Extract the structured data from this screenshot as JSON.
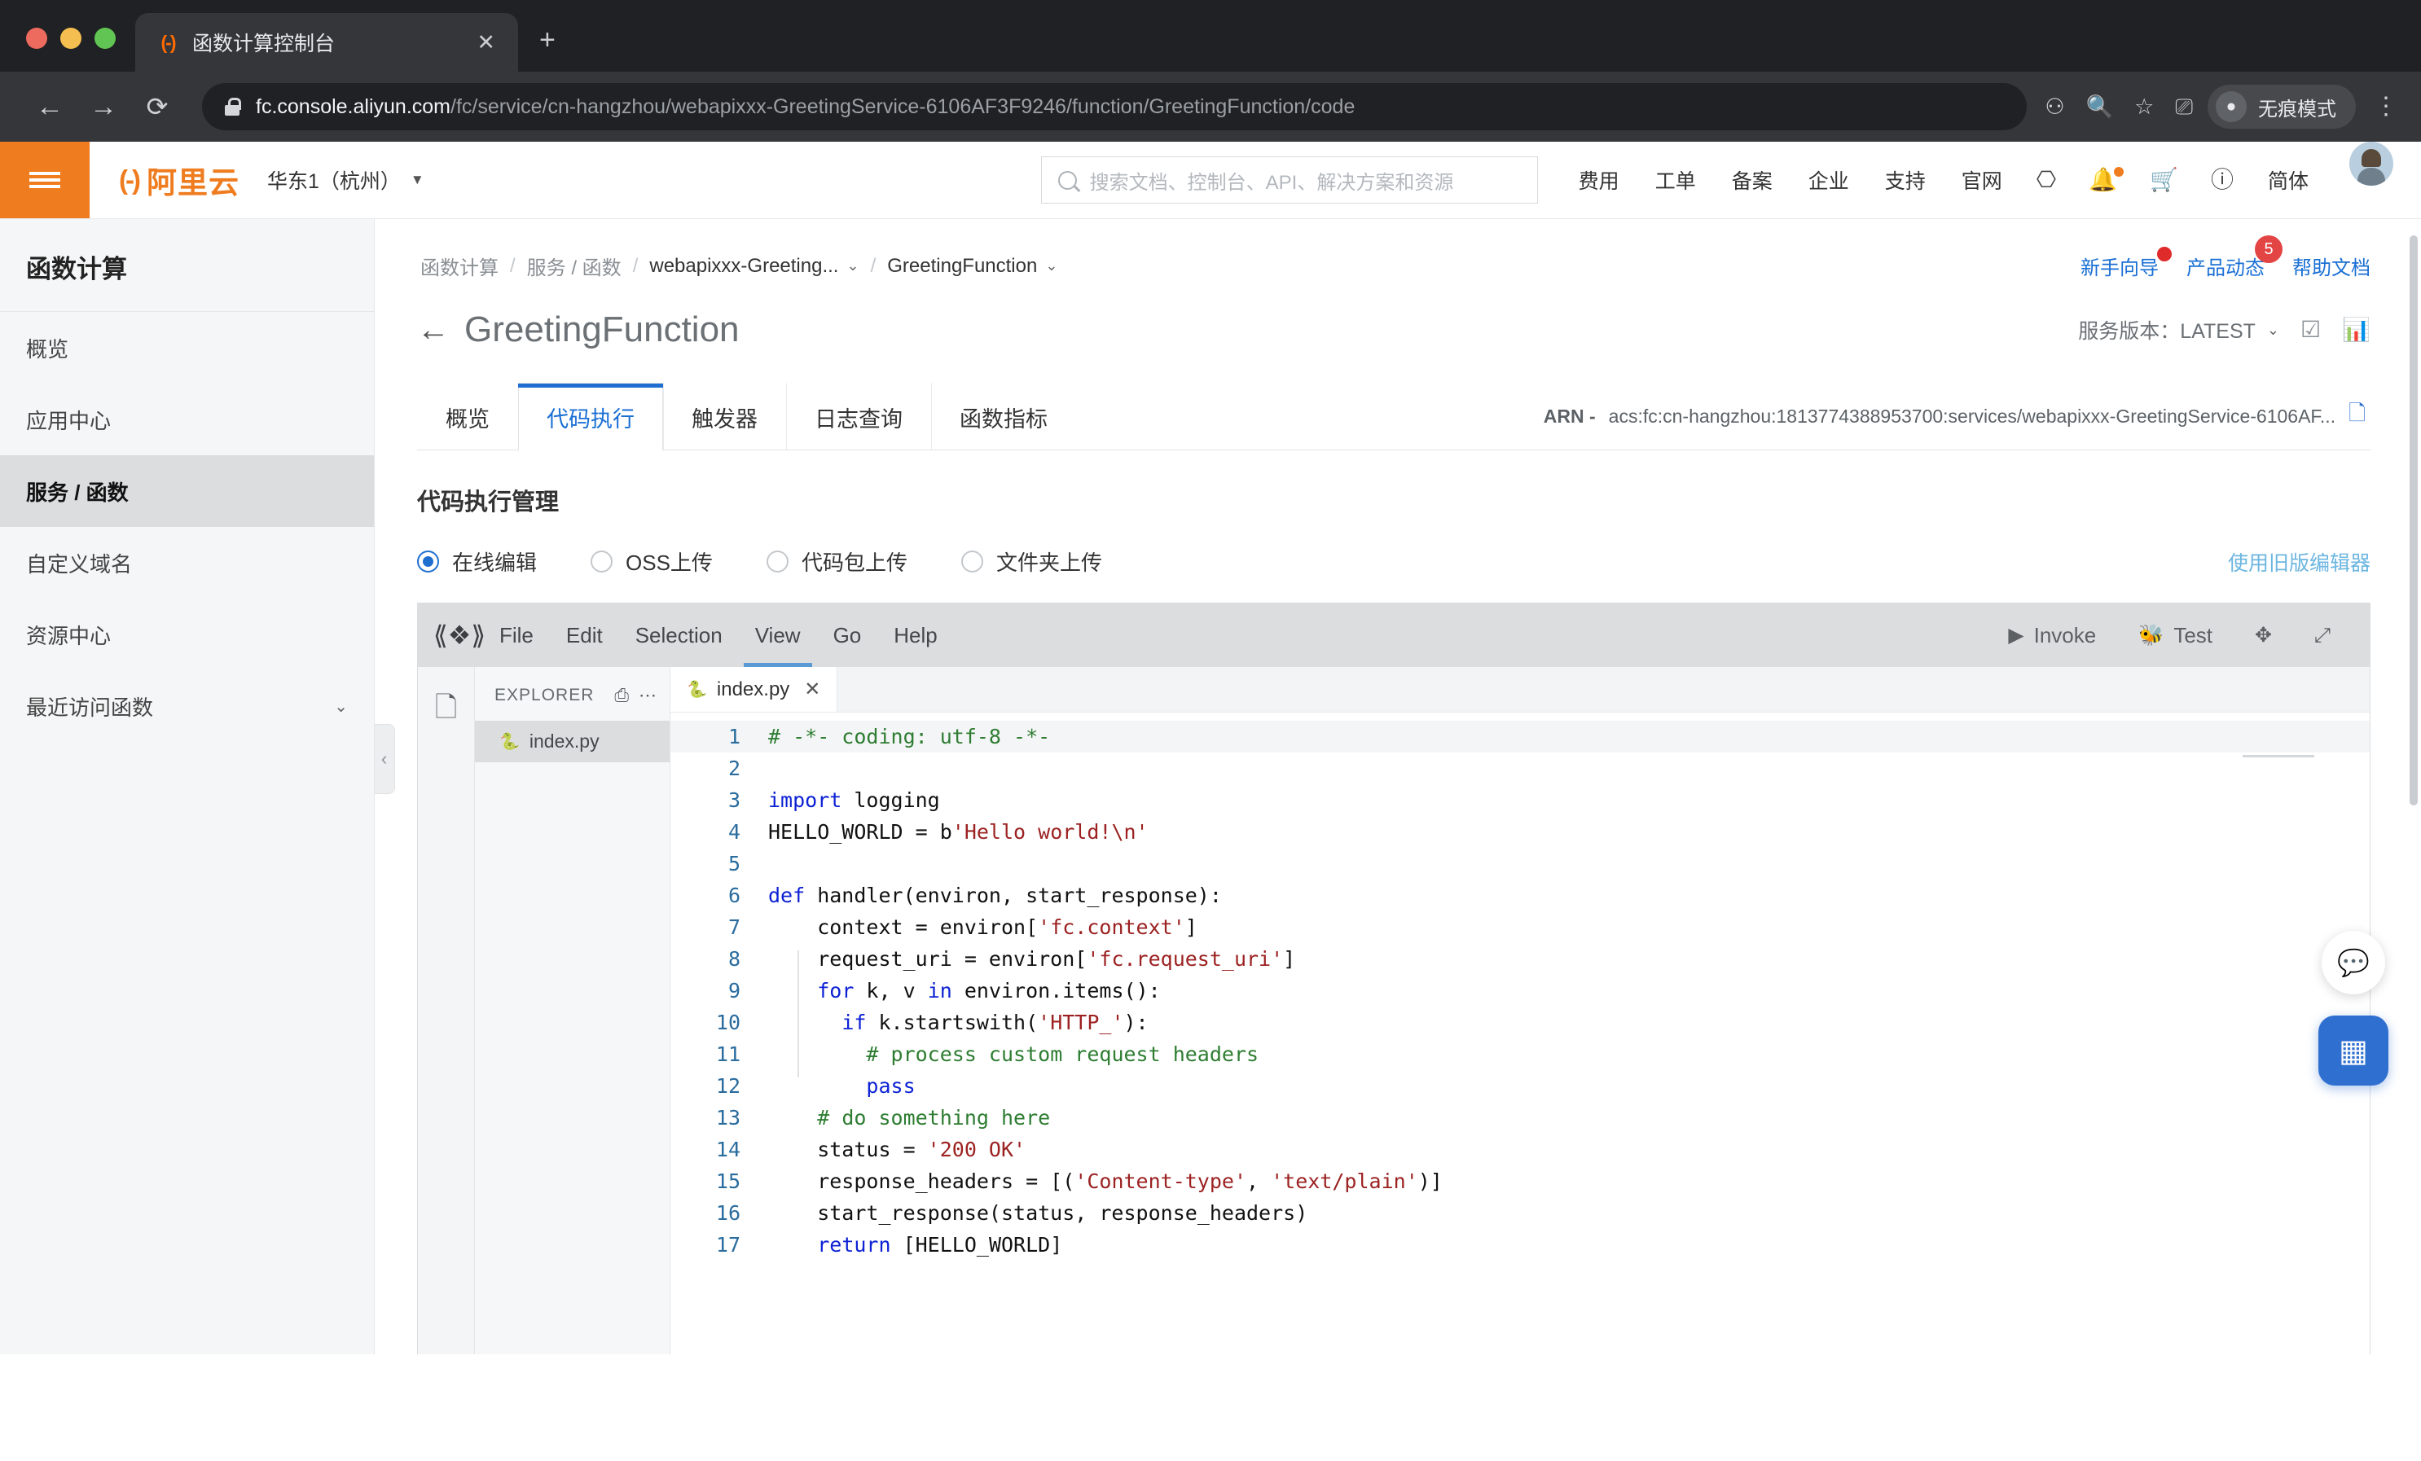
{
  "browser": {
    "tab": {
      "title": "函数计算控制台",
      "favicon": "aliyun-logo-icon",
      "close": "✕"
    },
    "newtab": "+",
    "nav": {
      "back": "←",
      "forward": "→",
      "reload": "⟳"
    },
    "url": {
      "host": "fc.console.aliyun.com",
      "path": "/fc/service/cn-hangzhou/webapixxx-GreetingService-6106AF3F9246/function/GreetingFunction/code"
    },
    "omni_icons": [
      "extensions-icon",
      "search-icon",
      "bookmark-star-icon",
      "cast-icon"
    ],
    "incognito_label": "无痕模式",
    "menu": "⋮"
  },
  "topnav": {
    "menu_icon": "hamburger-icon",
    "logo_mark": "(-)",
    "logo_text": "阿里云",
    "region": "华东1（杭州）",
    "region_caret": "▼",
    "search_placeholder": "搜索文档、控制台、API、解决方案和资源",
    "links": [
      "费用",
      "工单",
      "备案",
      "企业",
      "支持",
      "官网"
    ],
    "icons": [
      "shell-terminal-icon",
      "bell-notification-icon",
      "shopping-cart-icon",
      "help-question-icon"
    ],
    "language": "简体",
    "avatar": "user-avatar"
  },
  "sidebar": {
    "title": "函数计算",
    "items": [
      {
        "label": "概览",
        "active": false,
        "chevron": ""
      },
      {
        "label": "应用中心",
        "active": false,
        "chevron": ""
      },
      {
        "label": "服务 / 函数",
        "active": true,
        "chevron": ""
      },
      {
        "label": "自定义域名",
        "active": false,
        "chevron": ""
      },
      {
        "label": "资源中心",
        "active": false,
        "chevron": ""
      },
      {
        "label": "最近访问函数",
        "active": false,
        "chevron": "⌄"
      }
    ]
  },
  "breadcrumb": {
    "items": [
      {
        "label": "函数计算",
        "caret": ""
      },
      {
        "label": "服务 / 函数",
        "caret": ""
      },
      {
        "label": "webapixxx-Greeting...",
        "caret": "⌄"
      },
      {
        "label": "GreetingFunction",
        "caret": "⌄"
      }
    ],
    "separator": "/",
    "right_links": [
      {
        "label": "新手向导",
        "badge_dot": true
      },
      {
        "label": "产品动态",
        "badge_count": "5"
      },
      {
        "label": "帮助文档"
      }
    ]
  },
  "page": {
    "back_arrow": "←",
    "title": "GreetingFunction",
    "version_label": "服务版本：LATEST",
    "version_caret": "⌄",
    "head_icons": [
      "monitor-check-icon",
      "bar-chart-icon"
    ]
  },
  "tabs": [
    {
      "label": "概览",
      "selected": false
    },
    {
      "label": "代码执行",
      "selected": true
    },
    {
      "label": "触发器",
      "selected": false
    },
    {
      "label": "日志查询",
      "selected": false
    },
    {
      "label": "函数指标",
      "selected": false
    }
  ],
  "arn": {
    "label": "ARN -",
    "value": "acs:fc:cn-hangzhou:1813774388953700:services/webapixxx-GreetingService-6106AF...",
    "copy_icon": "copy-icon"
  },
  "section": {
    "title": "代码执行管理",
    "radios": [
      {
        "label": "在线编辑",
        "selected": true
      },
      {
        "label": "OSS上传",
        "selected": false
      },
      {
        "label": "代码包上传",
        "selected": false
      },
      {
        "label": "文件夹上传",
        "selected": false
      }
    ],
    "legacy_link": "使用旧版编辑器"
  },
  "ide": {
    "logo": "editor-logo-icon",
    "menus": [
      {
        "label": "File",
        "highlight": false
      },
      {
        "label": "Edit",
        "highlight": false
      },
      {
        "label": "Selection",
        "highlight": false
      },
      {
        "label": "View",
        "highlight": true
      },
      {
        "label": "Go",
        "highlight": false
      },
      {
        "label": "Help",
        "highlight": false
      }
    ],
    "actions": [
      {
        "label": "Invoke",
        "glyph": "▶",
        "icon": "play-icon"
      },
      {
        "label": "Test",
        "glyph": "🐞",
        "icon": "bug-icon"
      },
      {
        "label": "",
        "glyph": "✥",
        "icon": "move-icon"
      },
      {
        "label": "",
        "glyph": "⤢",
        "icon": "expand-icon"
      }
    ],
    "activity_icon": "files-explorer-icon",
    "explorer": {
      "title": "EXPLORER",
      "new_file_icon": "new-window-icon",
      "more_icon": "more-options-icon",
      "files": [
        {
          "name": "index.py",
          "icon": "python-file-icon",
          "selected": true
        }
      ]
    },
    "editor_tabs": [
      {
        "name": "index.py",
        "icon": "python-file-icon",
        "close": "✕",
        "active": true
      }
    ],
    "code_lines": [
      {
        "n": 1,
        "highlight": true,
        "tokens": [
          {
            "t": "# -*- coding: utf-8 -*-",
            "c": "cmt"
          }
        ]
      },
      {
        "n": 2,
        "highlight": false,
        "tokens": []
      },
      {
        "n": 3,
        "highlight": false,
        "tokens": [
          {
            "t": "import",
            "c": "kw"
          },
          {
            "t": " logging",
            "c": ""
          }
        ]
      },
      {
        "n": 4,
        "highlight": false,
        "tokens": [
          {
            "t": "HELLO_WORLD = b",
            "c": ""
          },
          {
            "t": "'Hello world!\\n'",
            "c": "str"
          }
        ]
      },
      {
        "n": 5,
        "highlight": false,
        "tokens": []
      },
      {
        "n": 6,
        "highlight": false,
        "tokens": [
          {
            "t": "def",
            "c": "kw"
          },
          {
            "t": " handler(environ, start_response):",
            "c": ""
          }
        ]
      },
      {
        "n": 7,
        "highlight": false,
        "tokens": [
          {
            "t": "    context = environ[",
            "c": ""
          },
          {
            "t": "'fc.context'",
            "c": "str"
          },
          {
            "t": "]",
            "c": ""
          }
        ]
      },
      {
        "n": 8,
        "highlight": false,
        "tokens": [
          {
            "t": "    request_uri = environ[",
            "c": ""
          },
          {
            "t": "'fc.request_uri'",
            "c": "str"
          },
          {
            "t": "]",
            "c": ""
          }
        ]
      },
      {
        "n": 9,
        "highlight": false,
        "tokens": [
          {
            "t": "    ",
            "c": ""
          },
          {
            "t": "for",
            "c": "kw"
          },
          {
            "t": " k, v ",
            "c": ""
          },
          {
            "t": "in",
            "c": "kw"
          },
          {
            "t": " environ.items():",
            "c": ""
          }
        ]
      },
      {
        "n": 10,
        "highlight": false,
        "tokens": [
          {
            "t": "      ",
            "c": ""
          },
          {
            "t": "if",
            "c": "kw"
          },
          {
            "t": " k.startswith(",
            "c": ""
          },
          {
            "t": "'HTTP_'",
            "c": "str"
          },
          {
            "t": "):",
            "c": ""
          }
        ]
      },
      {
        "n": 11,
        "highlight": false,
        "tokens": [
          {
            "t": "        ",
            "c": ""
          },
          {
            "t": "# process custom request headers",
            "c": "cmt"
          }
        ]
      },
      {
        "n": 12,
        "highlight": false,
        "tokens": [
          {
            "t": "        ",
            "c": ""
          },
          {
            "t": "pass",
            "c": "kw"
          }
        ]
      },
      {
        "n": 13,
        "highlight": false,
        "tokens": [
          {
            "t": "    ",
            "c": ""
          },
          {
            "t": "# do something here",
            "c": "cmt"
          }
        ]
      },
      {
        "n": 14,
        "highlight": false,
        "tokens": [
          {
            "t": "    status = ",
            "c": ""
          },
          {
            "t": "'200 OK'",
            "c": "str"
          }
        ]
      },
      {
        "n": 15,
        "highlight": false,
        "tokens": [
          {
            "t": "    response_headers = [(",
            "c": ""
          },
          {
            "t": "'Content-type'",
            "c": "str"
          },
          {
            "t": ", ",
            "c": ""
          },
          {
            "t": "'text/plain'",
            "c": "str"
          },
          {
            "t": ")]",
            "c": ""
          }
        ]
      },
      {
        "n": 16,
        "highlight": false,
        "tokens": [
          {
            "t": "    start_response(status, response_headers)",
            "c": ""
          }
        ]
      },
      {
        "n": 17,
        "highlight": false,
        "tokens": [
          {
            "t": "    ",
            "c": ""
          },
          {
            "t": "return",
            "c": "kw"
          },
          {
            "t": " [HELLO_WORLD]",
            "c": ""
          }
        ]
      }
    ]
  },
  "floaters": [
    {
      "icon": "chat-bubble-icon",
      "glyph": "💬",
      "style": "light"
    },
    {
      "icon": "apps-grid-icon",
      "glyph": "▦",
      "style": "primary"
    }
  ],
  "collapse_handle": "‹",
  "colors": {
    "brand_orange": "#ef7c1f",
    "accent_blue": "#1f6fd0",
    "badge_red": "#e34444",
    "comment_green": "#2e7d32",
    "string_red": "#9c2222",
    "keyword_blue": "#0d22d4"
  }
}
